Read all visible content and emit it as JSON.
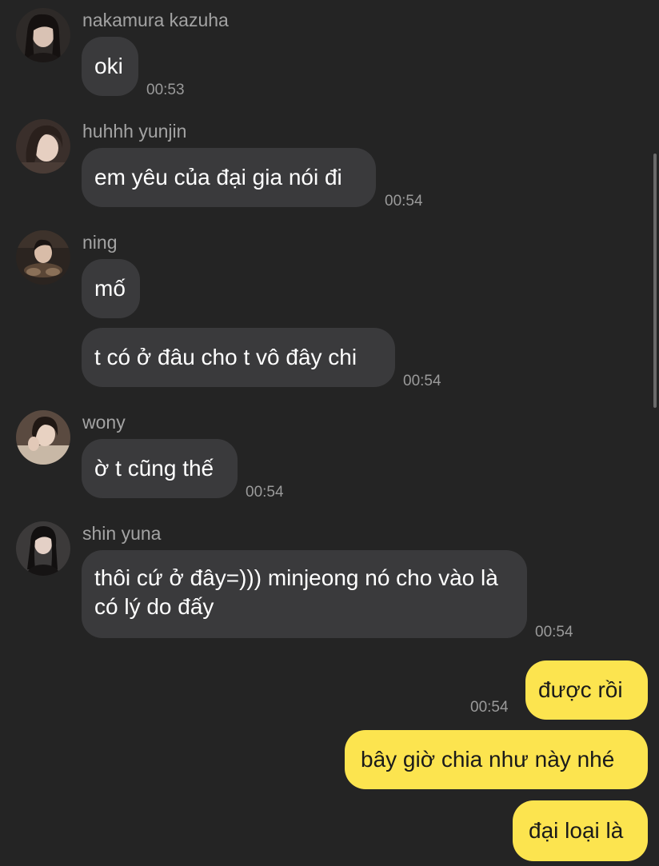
{
  "messages": [
    {
      "sender": "nakamura kazuha",
      "texts": [
        "oki"
      ],
      "time": "00:53"
    },
    {
      "sender": "huhhh yunjin",
      "texts": [
        "em yêu của đại gia nói đi"
      ],
      "time": "00:54"
    },
    {
      "sender": "ning",
      "texts": [
        "mố",
        "t có ở đâu cho t vô đây chi"
      ],
      "time": "00:54"
    },
    {
      "sender": "wony",
      "texts": [
        "ờ t cũng thế"
      ],
      "time": "00:54"
    },
    {
      "sender": "shin yuna",
      "texts": [
        "thôi cứ ở đây=))) minjeong nó cho vào là có lý do đấy"
      ],
      "time": "00:54"
    }
  ],
  "outgoing": {
    "texts": [
      "được rồi",
      "bây giờ chia như này nhé",
      "đại loại là"
    ],
    "time": "00:54"
  },
  "colors": {
    "background": "#242424",
    "incoming_bubble": "#3a3a3c",
    "outgoing_bubble": "#fce44f"
  }
}
